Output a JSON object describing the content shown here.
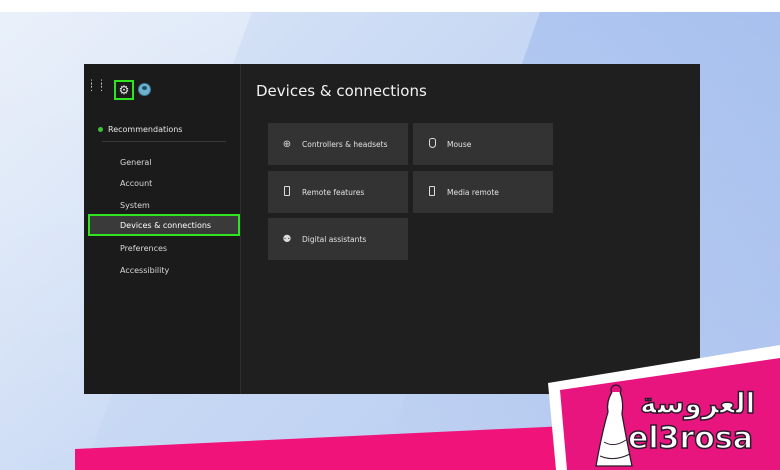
{
  "colors": {
    "highlight": "#2ee51f",
    "window_bg": "#1f1f1f",
    "card_bg": "#333333",
    "banner_pink": "#f0147a"
  },
  "sidebar": {
    "recommendations": "Recommendations",
    "items": [
      {
        "label": "General"
      },
      {
        "label": "Account"
      },
      {
        "label": "System"
      },
      {
        "label": "Devices & connections",
        "active": true
      },
      {
        "label": "Preferences"
      },
      {
        "label": "Accessibility"
      }
    ]
  },
  "main": {
    "title": "Devices & connections",
    "cards": [
      {
        "label": "Controllers & headsets",
        "icon": "controller-icon"
      },
      {
        "label": "Mouse",
        "icon": "mouse-icon"
      },
      {
        "label": "Remote features",
        "icon": "phone-icon"
      },
      {
        "label": "Media remote",
        "icon": "remote-icon"
      },
      {
        "label": "Digital assistants",
        "icon": "assistant-icon"
      }
    ]
  },
  "watermark": {
    "arabic": "العروسة",
    "latin": "el3rosa"
  }
}
